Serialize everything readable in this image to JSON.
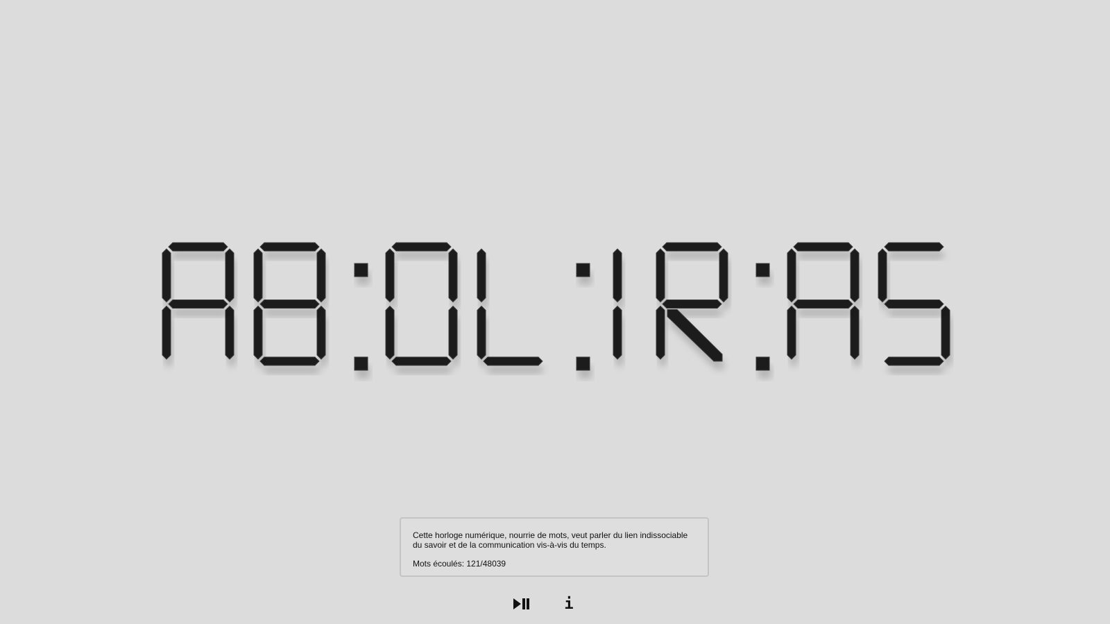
{
  "clock": {
    "display": "AB:OL:IR:AS",
    "digits": [
      "A",
      "B",
      "O",
      "L",
      "I",
      "R",
      "A",
      "S"
    ],
    "segment_color": "#1c1c1c",
    "background_color": "#dcdcdc"
  },
  "info": {
    "description": "Cette horloge numérique, nourrie de mots, veut parler du lien indissociable du savoir et de la communication vis-à-vis du temps.",
    "counter_label": "Mots écoulés: 121/48039"
  },
  "controls": {
    "play_pause_icon": "play-pause-icon",
    "info_icon": "info-icon",
    "info_glyph": "i"
  }
}
